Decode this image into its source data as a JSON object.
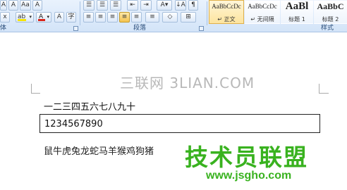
{
  "ribbon": {
    "font_row1": [
      "A",
      "A",
      "Aa",
      "A"
    ],
    "font_row2": [
      "ab",
      "A",
      "Aa",
      "A",
      "字"
    ],
    "font_group": "体",
    "para_row1": [
      "≡",
      "≡",
      "≡",
      "≡",
      "↕",
      "↓A",
      "¶"
    ],
    "para_row2": [
      "≡",
      "≡",
      "≡",
      "≡",
      "≡",
      "≡",
      "◇",
      "⊞"
    ],
    "paragraph_label": "段落",
    "styles_label": "样式",
    "styles": [
      {
        "preview": "AaBbCcDc",
        "name": "↵ 正文",
        "selected": true
      },
      {
        "preview": "AaBbCcDc",
        "name": "↵ 无间隔",
        "selected": false
      },
      {
        "preview": "AaBl",
        "name": "标题 1",
        "selected": false
      },
      {
        "preview": "AaBbC",
        "name": "标题 2",
        "selected": false
      }
    ]
  },
  "document": {
    "watermark": "三联网 3LIAN.COM",
    "line1": "一二三四五六七八九十",
    "boxed_text": "1234567890",
    "line3": "鼠牛虎兔龙蛇马羊猴鸡狗猪",
    "logo_cn": "技术员联盟",
    "logo_url": "www.jsgho.com"
  },
  "colors": {
    "highlight": "#f5e400",
    "font_red": "#d9241a",
    "logo_green": "#39b21f"
  }
}
